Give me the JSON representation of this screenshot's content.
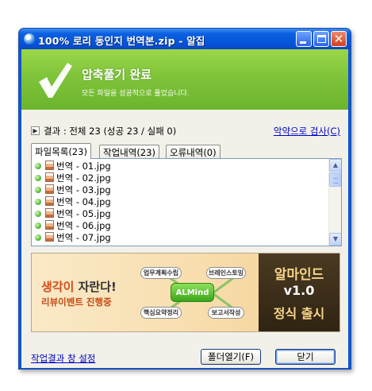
{
  "window": {
    "title": "100% 로리 동인지 번역본.zip - 알집",
    "icon": "alzip-app-icon"
  },
  "banner": {
    "title": "압축풀기 완료",
    "subtitle": "모든 파일을 성공적으로 풀었습니다.",
    "icon": "check-icon",
    "accent_color": "#7fc43a"
  },
  "result": {
    "summary": "결과 : 전체 23 (성공 23 / 실패 0)",
    "search_link": "악약으로 검사(C)"
  },
  "tabs": [
    {
      "label": "파일목록(23)",
      "active": true
    },
    {
      "label": "작업내역(23)",
      "active": false
    },
    {
      "label": "오류내역(0)",
      "active": false
    }
  ],
  "files": [
    {
      "name": "번역 - 01.jpg"
    },
    {
      "name": "번역 - 02.jpg"
    },
    {
      "name": "번역 - 03.jpg"
    },
    {
      "name": "번역 - 04.jpg"
    },
    {
      "name": "번역 - 05.jpg"
    },
    {
      "name": "번역 - 06.jpg"
    },
    {
      "name": "번역 - 07.jpg"
    }
  ],
  "ad": {
    "headline_emph": "생각이",
    "headline_rest": " 자란다!",
    "sub": "리뷰이벤트 진행중",
    "pills": [
      "업무계획수립",
      "브레인스토밍",
      "핵심요약정리",
      "보고서작성"
    ],
    "center": "ALMind",
    "right_line1": "알마인드",
    "right_line2": "v1.0",
    "right_line3": "정식 출시"
  },
  "footer": {
    "settings_link": "작업결과 창 설정",
    "open_folder": "폴더열기(F)",
    "close": "닫기"
  }
}
